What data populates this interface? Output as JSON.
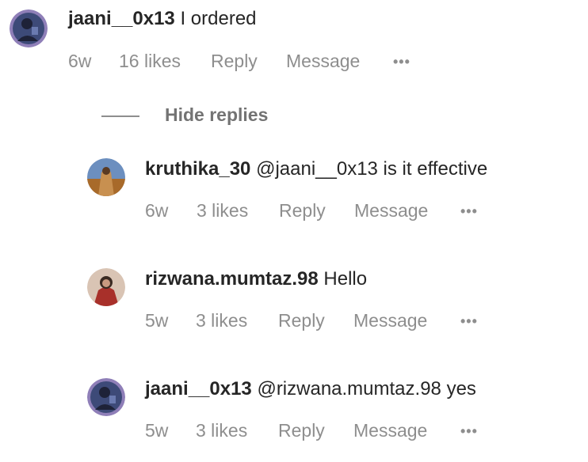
{
  "comments": [
    {
      "username": "jaani__0x13",
      "text": "I ordered",
      "time": "6w",
      "likes": "16 likes",
      "reply": "Reply",
      "message": "Message",
      "more": "•••",
      "avatar_colors": [
        "#3a4a7a",
        "#7a5a9a"
      ]
    }
  ],
  "hide_replies": "Hide replies",
  "replies": [
    {
      "username": "kruthika_30",
      "text": "@jaani__0x13 is it effective",
      "time": "6w",
      "likes": "3 likes",
      "reply": "Reply",
      "message": "Message",
      "more": "•••",
      "avatar_colors": [
        "#c98a3a",
        "#5a7ab0"
      ]
    },
    {
      "username": "rizwana.mumtaz.98",
      "text": "Hello",
      "time": "5w",
      "likes": "3 likes",
      "reply": "Reply",
      "message": "Message",
      "more": "•••",
      "avatar_colors": [
        "#b5413a",
        "#e8c8b0"
      ]
    },
    {
      "username": "jaani__0x13",
      "text": "@rizwana.mumtaz.98 yes",
      "time": "5w",
      "likes": "3 likes",
      "reply": "Reply",
      "message": "Message",
      "more": "•••",
      "avatar_colors": [
        "#3a4a7a",
        "#7a5a9a"
      ]
    }
  ]
}
